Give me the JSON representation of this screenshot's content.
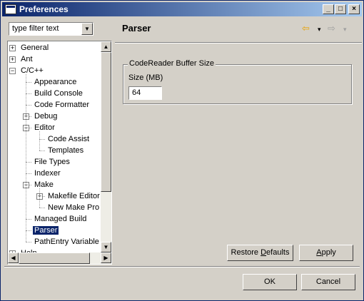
{
  "window": {
    "title": "Preferences"
  },
  "titlebar_buttons": {
    "minimize": "_",
    "maximize": "□",
    "close": "×"
  },
  "filter": {
    "value": "type filter text"
  },
  "tree": {
    "items": [
      {
        "label": "General",
        "expander": "+",
        "level": 0
      },
      {
        "label": "Ant",
        "expander": "+",
        "level": 0
      },
      {
        "label": "C/C++",
        "expander": "−",
        "level": 0
      },
      {
        "label": "Appearance",
        "level": 1
      },
      {
        "label": "Build Console",
        "level": 1
      },
      {
        "label": "Code Formatter",
        "level": 1
      },
      {
        "label": "Debug",
        "expander": "+",
        "level": 1
      },
      {
        "label": "Editor",
        "expander": "−",
        "level": 1
      },
      {
        "label": "Code Assist",
        "level": 2
      },
      {
        "label": "Templates",
        "level": 2
      },
      {
        "label": "File Types",
        "level": 1
      },
      {
        "label": "Indexer",
        "level": 1
      },
      {
        "label": "Make",
        "expander": "−",
        "level": 1
      },
      {
        "label": "Makefile Editor",
        "expander": "+",
        "level": 2
      },
      {
        "label": "New Make Pro",
        "level": 2
      },
      {
        "label": "Managed Build",
        "level": 1
      },
      {
        "label": "Parser",
        "level": 1,
        "selected": true
      },
      {
        "label": "PathEntry Variable",
        "level": 1
      },
      {
        "label": "Help",
        "expander": "+",
        "level": 0
      }
    ]
  },
  "page": {
    "title": "Parser",
    "back_icon": "back-arrow-icon",
    "forward_icon": "forward-arrow-icon"
  },
  "group": {
    "title": "CodeReader Buffer Size",
    "size_label": "Size (MB)",
    "size_value": "64"
  },
  "buttons": {
    "restore_defaults_pre": "Restore ",
    "restore_defaults_mn": "D",
    "restore_defaults_post": "efaults",
    "apply_mn": "A",
    "apply_post": "pply",
    "ok": "OK",
    "cancel": "Cancel"
  }
}
